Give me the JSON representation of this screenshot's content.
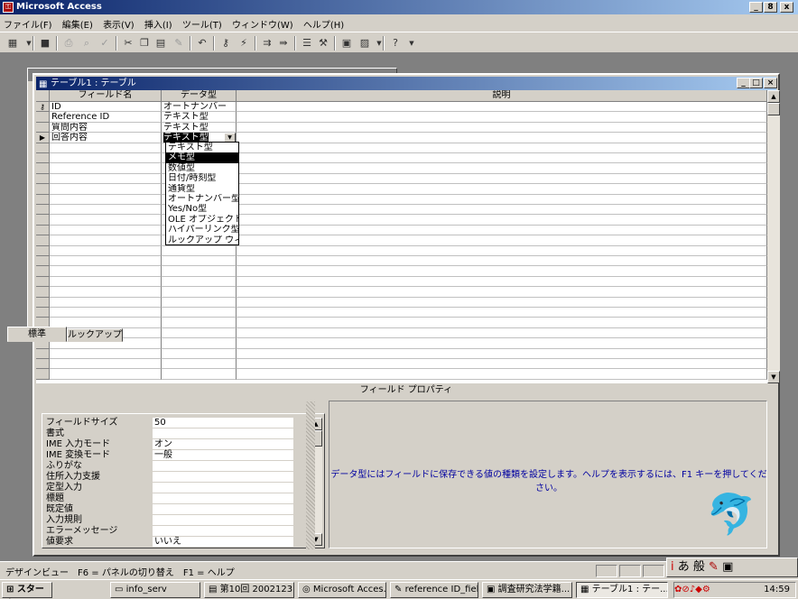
{
  "app": {
    "title": "Microsoft Access"
  },
  "menu": [
    "ファイル(F)",
    "編集(E)",
    "表示(V)",
    "挿入(I)",
    "ツール(T)",
    "ウィンドウ(W)",
    "ヘルプ(H)"
  ],
  "caption_buttons": [
    "_",
    "8",
    "x"
  ],
  "table_window": {
    "title": "テーブル1 : テーブル",
    "buttons": [
      "_",
      "□",
      "×"
    ]
  },
  "grid": {
    "headers": {
      "field_name": "フィールド名",
      "data_type": "データ型",
      "description": "説明"
    },
    "rows": [
      {
        "field": "ID",
        "type": "オートナンバー",
        "key": true
      },
      {
        "field": "Reference ID",
        "type": "テキスト型"
      },
      {
        "field": "質問内容",
        "type": "テキスト型"
      },
      {
        "field": "回答内容",
        "type": "テキスト型",
        "current": true
      }
    ]
  },
  "dropdown": {
    "options": [
      "テキスト型",
      "メモ型",
      "数値型",
      "日付/時刻型",
      "通貨型",
      "オートナンバー型",
      "Yes/No型",
      "OLE オブジェクト型",
      "ハイパーリンク型",
      "ルックアップ ウィザード"
    ],
    "highlighted_index": 1
  },
  "properties": {
    "section_label": "フィールド プロパティ",
    "tabs": [
      "標準",
      "ルックアップ"
    ],
    "items": [
      {
        "label": "フィールドサイズ",
        "value": "50"
      },
      {
        "label": "書式",
        "value": ""
      },
      {
        "label": "IME 入力モード",
        "value": "オン"
      },
      {
        "label": "IME 変換モード",
        "value": "一般"
      },
      {
        "label": "ふりがな",
        "value": ""
      },
      {
        "label": "住所入力支援",
        "value": ""
      },
      {
        "label": "定型入力",
        "value": ""
      },
      {
        "label": "標題",
        "value": ""
      },
      {
        "label": "既定値",
        "value": ""
      },
      {
        "label": "入力規則",
        "value": ""
      },
      {
        "label": "エラーメッセージ",
        "value": ""
      },
      {
        "label": "値要求",
        "value": "いいえ"
      }
    ],
    "help": "データ型にはフィールドに保存できる値の種類を設定します。ヘルプを表示するには、F1 キーを押してください。"
  },
  "status": {
    "text": "デザインビュー　F6 = パネルの切り替え　F1 = ヘルプ"
  },
  "ime": {
    "text": "あ 般"
  },
  "taskbar": {
    "start": "スタート",
    "tasks": [
      {
        "label": "info_serv"
      },
      {
        "label": "第10回 2002123..."
      },
      {
        "label": "Microsoft Acces..."
      },
      {
        "label": "reference ID_fiel..."
      },
      {
        "label": "調査研究法学籍..."
      },
      {
        "label": "テーブル1 : テー...",
        "active": true
      }
    ],
    "clock": "14:59"
  },
  "colors": {
    "title_bar": "#0a246a",
    "help_text": "#0000a0",
    "chrome": "#d4d0c8",
    "desktop": "#808080"
  }
}
